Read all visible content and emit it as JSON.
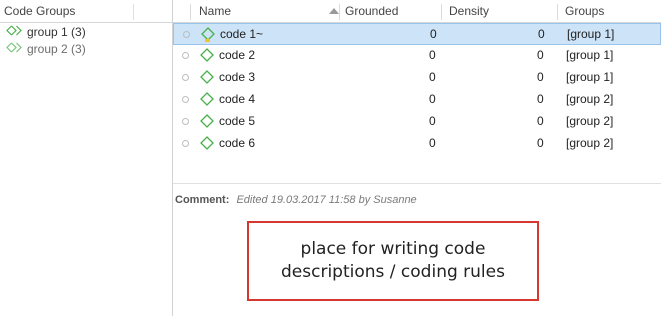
{
  "colors": {
    "selection_bg": "#cde3f7",
    "selection_border": "#99c3ea",
    "code_icon_green": "#48b04a",
    "note_border": "#d6372e",
    "comment_flag": "#f4c430"
  },
  "left": {
    "header": "Code Groups",
    "groups": [
      {
        "label": "group 1 (3)",
        "icon": "code-group-icon"
      },
      {
        "label": "group 2 (3)",
        "icon": "code-group-icon"
      }
    ]
  },
  "table": {
    "columns": {
      "name": "Name",
      "grounded": "Grounded",
      "density": "Density",
      "groups": "Groups"
    },
    "sort_indicator": "ascending",
    "rows": [
      {
        "name": "code 1~",
        "grounded": "0",
        "density": "0",
        "groups": "[group 1]",
        "selected": true,
        "has_comment": true
      },
      {
        "name": "code 2",
        "grounded": "0",
        "density": "0",
        "groups": "[group 1]"
      },
      {
        "name": "code 3",
        "grounded": "0",
        "density": "0",
        "groups": "[group 1]"
      },
      {
        "name": "code 4",
        "grounded": "0",
        "density": "0",
        "groups": "[group 2]"
      },
      {
        "name": "code 5",
        "grounded": "0",
        "density": "0",
        "groups": "[group 2]"
      },
      {
        "name": "code 6",
        "grounded": "0",
        "density": "0",
        "groups": "[group 2]"
      }
    ]
  },
  "comment": {
    "label": "Comment:",
    "text": "Edited 19.03.2017 11:58 by Susanne"
  },
  "note": {
    "line1": "place for writing code",
    "line2": "descriptions / coding rules"
  }
}
